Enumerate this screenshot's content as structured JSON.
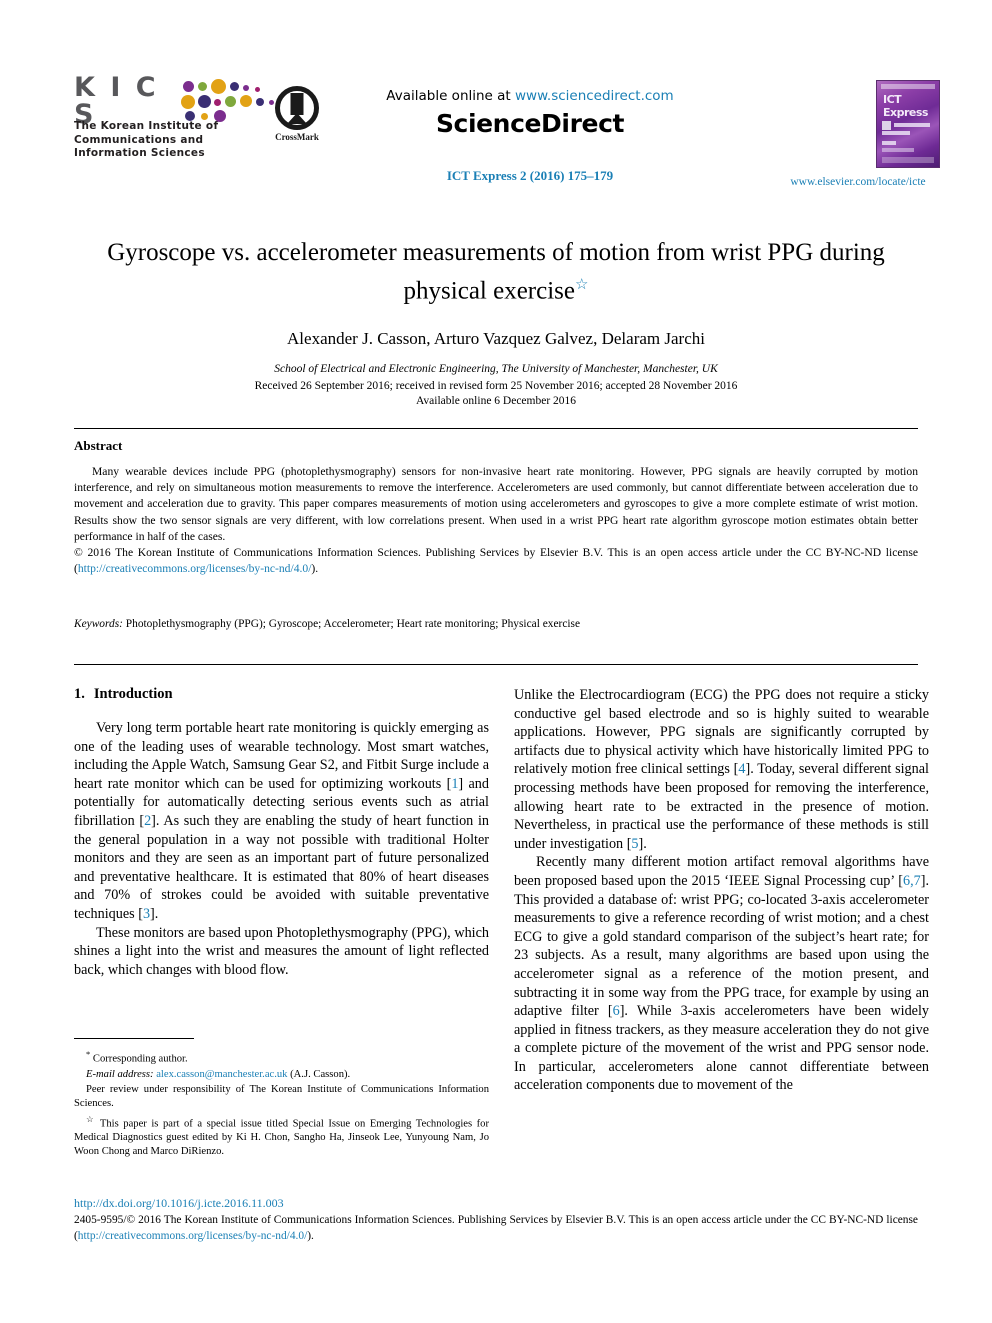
{
  "header": {
    "kics": {
      "letters": "K I C S",
      "subtitle_lines": [
        "The Korean Institute of",
        "Communications   and",
        "Information   Sciences"
      ]
    },
    "crossmark": {
      "label": "CrossMark"
    },
    "sciencedirect": {
      "available_prefix": "Available online at ",
      "available_link": "www.sciencedirect.com",
      "brand": "ScienceDirect"
    },
    "journal_reference": "ICT Express 2 (2016) 175–179",
    "cover": {
      "title": "ICT Express"
    },
    "elsevier_link": "www.elsevier.com/locate/icte"
  },
  "article": {
    "title": "Gyroscope vs. accelerometer measurements of motion from wrist PPG during physical exercise",
    "title_footnote_mark": "☆",
    "authors": "Alexander J. Casson, Arturo Vazquez Galvez, Delaram Jarchi",
    "author_star": "*",
    "affiliation": "School of Electrical and Electronic Engineering, The University of Manchester, Manchester, UK",
    "received": "Received 26 September 2016; received in revised form 25 November 2016; accepted 28 November 2016",
    "available_online": "Available online 6 December 2016"
  },
  "abstract": {
    "heading": "Abstract",
    "paragraph": "Many wearable devices include PPG (photoplethysmography) sensors for non-invasive heart rate monitoring. However, PPG signals are heavily corrupted by motion interference, and rely on simultaneous motion measurements to remove the interference. Accelerometers are used commonly, but cannot differentiate between acceleration due to movement and acceleration due to gravity. This paper compares measurements of motion using accelerometers and gyroscopes to give a more complete estimate of wrist motion. Results show the two sensor signals are very different, with low correlations present. When used in a wrist PPG heart rate algorithm gyroscope motion estimates obtain better performance in half of the cases.",
    "copyright_pre": "© 2016 The Korean Institute of Communications Information Sciences. Publishing Services by Elsevier B.V. This is an open access article under the CC BY-NC-ND license (",
    "copyright_link": "http://creativecommons.org/licenses/by-nc-nd/4.0/",
    "copyright_post": ").",
    "keywords_label": "Keywords:",
    "keywords_value": " Photoplethysmography (PPG); Gyroscope; Accelerometer; Heart rate monitoring; Physical exercise"
  },
  "introduction": {
    "number": "1.",
    "heading": "Introduction",
    "left_p1_a": "Very long term portable heart rate monitoring is quickly emerging as one of the leading uses of wearable technology. Most smart watches, including the Apple Watch, Samsung Gear S2, and Fitbit Surge include a heart rate monitor which can be used for optimizing workouts [",
    "left_p1_ref1": "1",
    "left_p1_b": "] and potentially for automatically detecting serious events such as atrial fibrillation [",
    "left_p1_ref2": "2",
    "left_p1_c": "]. As such they are enabling the study of heart function in the general population in a way not possible with traditional Holter monitors and they are seen as an important part of future personalized and preventative healthcare. It is estimated that 80% of heart diseases and 70% of strokes could be avoided with suitable preventative techniques [",
    "left_p1_ref3": "3",
    "left_p1_d": "].",
    "left_p2": "These monitors are based upon Photoplethysmography (PPG), which shines a light into the wrist and measures the amount of light reflected back, which changes with blood flow.",
    "right_p1_a": "Unlike the Electrocardiogram (ECG) the PPG does not require a sticky conductive gel based electrode and so is highly suited to wearable applications. However, PPG signals are significantly corrupted by artifacts due to physical activity which have historically limited PPG to relatively motion free clinical settings [",
    "right_p1_ref4": "4",
    "right_p1_b": "]. Today, several different signal processing methods have been proposed for removing the interference, allowing heart rate to be extracted in the presence of motion. Nevertheless, in practical use the performance of these methods is still under investigation [",
    "right_p1_ref5": "5",
    "right_p1_c": "].",
    "right_p2_a": "Recently many different motion artifact removal algorithms have been proposed based upon the 2015 ‘IEEE Signal Processing cup’ [",
    "right_p2_ref67": "6,7",
    "right_p2_b": "]. This provided a database of: wrist PPG; co-located 3-axis accelerometer measurements to give a reference recording of wrist motion; and a chest ECG to give a gold standard comparison of the subject’s heart rate; for 23 subjects. As a result, many algorithms are based upon using the accelerometer signal as a reference of the motion present, and subtracting it in some way from the PPG trace, for example by using an adaptive filter [",
    "right_p2_ref6": "6",
    "right_p2_c": "]. While 3-axis accelerometers have been widely applied in fitness trackers, as they measure acceleration they do not give a complete picture of the movement of the wrist and PPG sensor node. In particular, accelerometers alone cannot differentiate between acceleration components due to movement of the"
  },
  "footnotes": {
    "corresponding_mark": "*",
    "corresponding": " Corresponding author.",
    "email_label": "E-mail address:",
    "email_link": "alex.casson@manchester.ac.uk",
    "email_suffix": " (A.J. Casson).",
    "peer_review": "Peer review under responsibility of The Korean Institute of Communications Information Sciences.",
    "special_issue_mark": "☆",
    "special_issue": " This paper is part of a special issue titled Special Issue on Emerging Technologies for Medical Diagnostics guest edited by Ki H. Chon, Sangho Ha, Jinseok Lee, Yunyoung Nam, Jo Woon Chong and Marco DiRienzo."
  },
  "footer": {
    "doi": "http://dx.doi.org/10.1016/j.icte.2016.11.003",
    "issn_copyright_pre": "2405-9595/© 2016 The Korean Institute of Communications Information Sciences. Publishing Services by Elsevier B.V. This is an open access article under the CC BY-NC-ND license (",
    "copyright_link": "http://creativecommons.org/licenses/by-nc-nd/4.0/",
    "copyright_post": ")."
  },
  "colors": {
    "link_blue": "#1a7fb5",
    "kics_gray": "#58585b",
    "dot_purple": "#7b2d8e",
    "dot_gold": "#e2a215",
    "dot_navy": "#3a2f74",
    "dot_green": "#7fa83c",
    "dot_magenta": "#a01f6e"
  }
}
